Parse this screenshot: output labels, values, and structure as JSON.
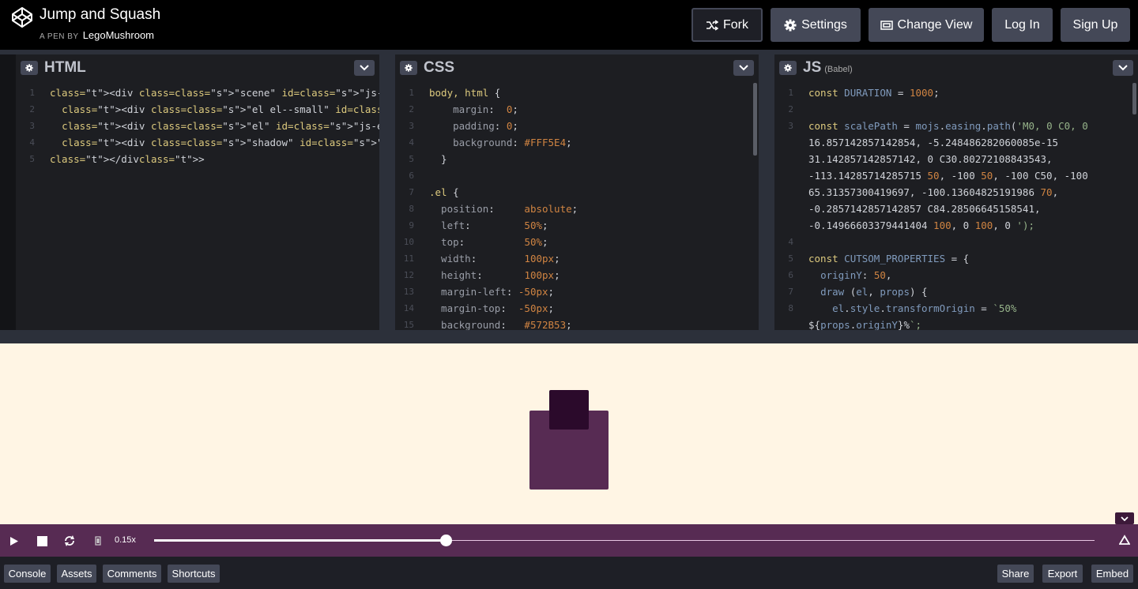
{
  "header": {
    "title": "Jump and Squash",
    "author_prefix": "A PEN BY",
    "author": "LegoMushroom",
    "buttons": {
      "fork": "Fork",
      "settings": "Settings",
      "change_view": "Change View",
      "login": "Log In",
      "signup": "Sign Up"
    }
  },
  "panes": {
    "html": {
      "title": "HTML",
      "lines": [
        {
          "n": "1",
          "code": "<div class=\"scene\" id=\"js-scene\">"
        },
        {
          "n": "2",
          "code": "  <div class=\"el el--small\" id=\"js-el-small\"></div>"
        },
        {
          "n": "3",
          "code": "  <div class=\"el\" id=\"js-el\"></div>"
        },
        {
          "n": "4",
          "code": "  <div class=\"shadow\" id=\"js-shadow\"></div>"
        },
        {
          "n": "5",
          "code": "</div>"
        }
      ]
    },
    "css": {
      "title": "CSS",
      "lines": [
        {
          "n": "1",
          "code": "body, html {"
        },
        {
          "n": "2",
          "code": "    margin:  0;"
        },
        {
          "n": "3",
          "code": "    padding: 0;"
        },
        {
          "n": "4",
          "code": "    background: #FFF5E4;"
        },
        {
          "n": "5",
          "code": "  }"
        },
        {
          "n": "6",
          "code": ""
        },
        {
          "n": "7",
          "code": ".el {"
        },
        {
          "n": "8",
          "code": "  position:     absolute;"
        },
        {
          "n": "9",
          "code": "  left:         50%;"
        },
        {
          "n": "10",
          "code": "  top:          50%;"
        },
        {
          "n": "11",
          "code": "  width:        100px;"
        },
        {
          "n": "12",
          "code": "  height:       100px;"
        },
        {
          "n": "13",
          "code": "  margin-left: -50px;"
        },
        {
          "n": "14",
          "code": "  margin-top:  -50px;"
        },
        {
          "n": "15",
          "code": "  background:   #572B53;"
        }
      ]
    },
    "js": {
      "title": "JS",
      "subtitle": "(Babel)",
      "lines": [
        {
          "n": "1",
          "code": "const DURATION = 1000;"
        },
        {
          "n": "2",
          "code": ""
        },
        {
          "n": "3",
          "code": "const scalePath = mojs.easing.path('M0, 0 C0, 0"
        },
        {
          "n": "",
          "code": "16.857142857142854, -5.248486282060085e-15"
        },
        {
          "n": "",
          "code": "31.142857142857142, 0 C30.80272108843543,"
        },
        {
          "n": "",
          "code": "-113.14285714285715 50, -100 50, -100 C50, -100"
        },
        {
          "n": "",
          "code": "65.31357300419697, -100.13604825191986 70,"
        },
        {
          "n": "",
          "code": "-0.2857142857142857 C84.28506645158541,"
        },
        {
          "n": "",
          "code": "-0.14966603379441404 100, 0 100, 0 ');"
        },
        {
          "n": "4",
          "code": ""
        },
        {
          "n": "5",
          "code": "const CUTSOM_PROPERTIES = {"
        },
        {
          "n": "6",
          "code": "  originY: 50,"
        },
        {
          "n": "7",
          "code": "  draw (el, props) {"
        },
        {
          "n": "8",
          "code": "    el.style.transformOrigin = `50%"
        },
        {
          "n": "",
          "code": "${props.originY}%`;"
        }
      ]
    }
  },
  "player": {
    "speed": "0.15x",
    "progress": 0.31
  },
  "footer": {
    "console": "Console",
    "assets": "Assets",
    "comments": "Comments",
    "shortcuts": "Shortcuts",
    "share": "Share",
    "export": "Export",
    "embed": "Embed"
  },
  "colors": {
    "result_background": "#FFF5E4",
    "el_color": "#572B53",
    "el_small_color": "#2B0A2B"
  }
}
